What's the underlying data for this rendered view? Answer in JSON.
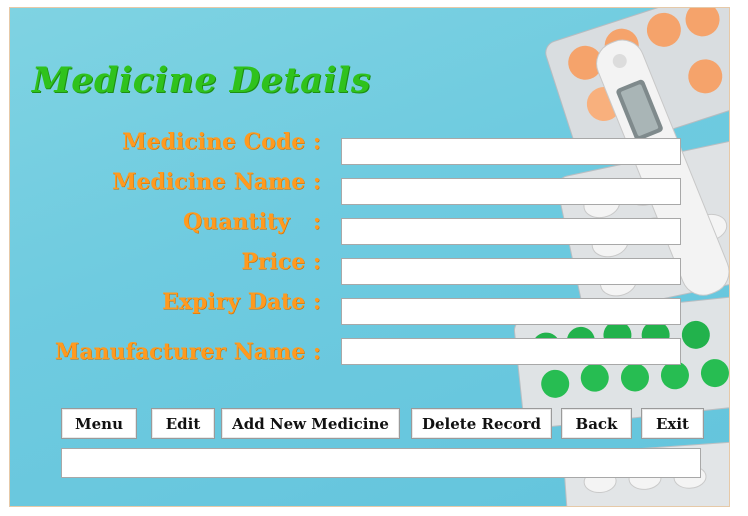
{
  "window": {
    "title": "Medicine Details"
  },
  "form": {
    "fields": [
      {
        "label": "Medicine Code :",
        "value": ""
      },
      {
        "label": "Medicine Name :",
        "value": ""
      },
      {
        "label": "Quantity   :",
        "value": ""
      },
      {
        "label": "Price :",
        "value": ""
      },
      {
        "label": "Expiry Date :",
        "value": ""
      },
      {
        "label": "Manufacturer Name :",
        "value": ""
      }
    ]
  },
  "buttons": {
    "menu": "Menu",
    "edit": "Edit",
    "add": "Add New Medicine",
    "delete": "Delete Record",
    "back": "Back",
    "exit": "Exit"
  },
  "status_bar": {
    "text": ""
  },
  "colors": {
    "background": "#6fcbe0",
    "title": "#2fc21c",
    "label": "#ff9a1f",
    "field_bg": "#ffffff"
  },
  "decor": {
    "image": "medicine-pills-thermometer-image"
  }
}
